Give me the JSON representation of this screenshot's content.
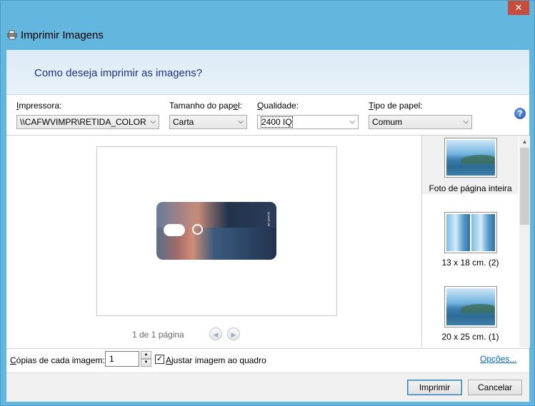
{
  "window": {
    "title": "Imprimir Imagens",
    "close_symbol": "✕"
  },
  "header": {
    "question": "Como deseja imprimir as imagens?"
  },
  "settings": {
    "printer": {
      "label_prefix": "I",
      "label_rest": "mpressora:",
      "value": "\\\\CAFWVIMPR\\RETIDA_COLOR"
    },
    "paper_size": {
      "label_prefix": "Tamanho do pap",
      "label_underline": "e",
      "label_rest": "l:",
      "value": "Carta"
    },
    "quality": {
      "label_prefix": "Q",
      "label_rest": "ualidade:",
      "value": "2400 IQ"
    },
    "paper_type": {
      "label_prefix": "T",
      "label_rest": "ipo de papel:",
      "value": "Comum"
    },
    "help_symbol": "?"
  },
  "preview": {
    "page_indicator": "1 de 1 página",
    "photo_brand": "QUANTUM"
  },
  "layouts": [
    {
      "label": "Foto de página inteira"
    },
    {
      "label": "13 x 18 cm. (2)"
    },
    {
      "label": "20 x 25 cm. (1)"
    }
  ],
  "bottom": {
    "copies_label_prefix": "C",
    "copies_label_rest": "ópias de cada imagem:",
    "copies_value": "1",
    "fit_checked": true,
    "fit_label_prefix": "A",
    "fit_label_rest": "justar imagem ao quadro",
    "options_link": "Opções..."
  },
  "footer": {
    "print_button": "Imprimir",
    "cancel_button": "Cancelar"
  },
  "colors": {
    "accent": "#63b6de",
    "header_text": "#1e3287",
    "link": "#0066cc"
  }
}
